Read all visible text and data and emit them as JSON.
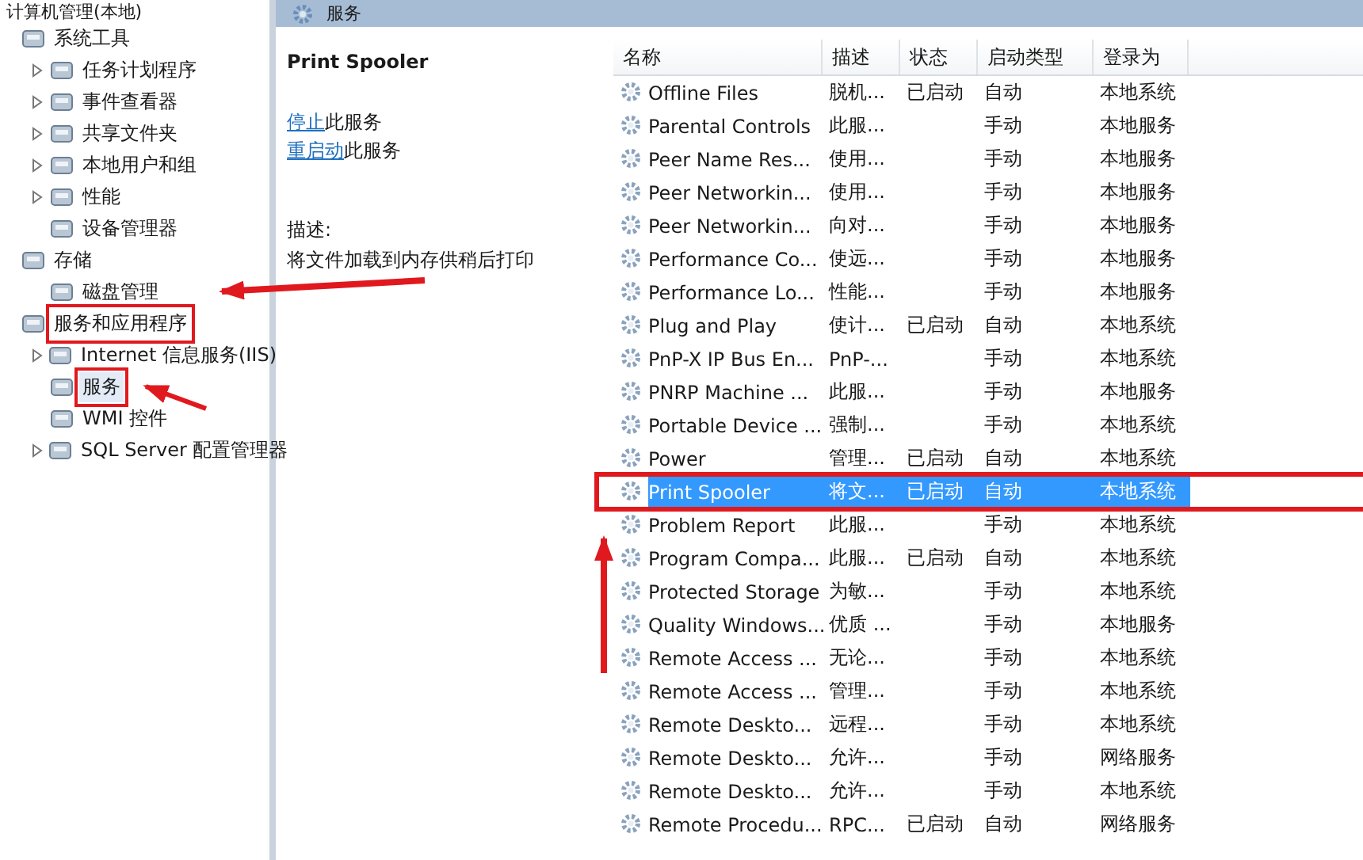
{
  "tree": {
    "label": "计算机管理(本地)",
    "children": [
      {
        "label": "系统工具",
        "expandable": false,
        "annotated": false,
        "selected": false,
        "children": [
          {
            "label": "任务计划程序",
            "expandable": true,
            "annotated": false,
            "selected": false
          },
          {
            "label": "事件查看器",
            "expandable": true,
            "annotated": false,
            "selected": false
          },
          {
            "label": "共享文件夹",
            "expandable": true,
            "annotated": false,
            "selected": false
          },
          {
            "label": "本地用户和组",
            "expandable": true,
            "annotated": false,
            "selected": false
          },
          {
            "label": "性能",
            "expandable": true,
            "annotated": false,
            "selected": false
          },
          {
            "label": "设备管理器",
            "expandable": false,
            "annotated": false,
            "selected": false
          }
        ]
      },
      {
        "label": "存储",
        "expandable": false,
        "annotated": false,
        "selected": false,
        "children": [
          {
            "label": "磁盘管理",
            "expandable": false,
            "annotated": false,
            "selected": false
          }
        ]
      },
      {
        "label": "服务和应用程序",
        "expandable": false,
        "annotated": true,
        "selected": false,
        "children": [
          {
            "label": "Internet 信息服务(IIS)",
            "expandable": true,
            "annotated": false,
            "selected": false
          },
          {
            "label": "服务",
            "expandable": false,
            "annotated": true,
            "selected": true
          },
          {
            "label": "WMI 控件",
            "expandable": false,
            "annotated": false,
            "selected": false
          },
          {
            "label": "SQL Server 配置管理器",
            "expandable": true,
            "annotated": false,
            "selected": false
          }
        ]
      }
    ]
  },
  "header": {
    "title": "服务"
  },
  "details": {
    "service_name": "Print Spooler",
    "actions": [
      {
        "link": "停止",
        "text": "此服务"
      },
      {
        "link": "重启动",
        "text": "此服务"
      }
    ],
    "description_label": "描述:",
    "description": "将文件加载到内存供稍后打印"
  },
  "table": {
    "columns": [
      "名称",
      "描述",
      "状态",
      "启动类型",
      "登录为"
    ],
    "rows": [
      {
        "name": "Offline Files",
        "description": "脱机...",
        "status": "已启动",
        "startup": "自动",
        "logon": "本地系统",
        "selected": false,
        "annotated": false
      },
      {
        "name": "Parental Controls",
        "description": "此服...",
        "status": "",
        "startup": "手动",
        "logon": "本地服务",
        "selected": false,
        "annotated": false
      },
      {
        "name": "Peer Name Res...",
        "description": "使用...",
        "status": "",
        "startup": "手动",
        "logon": "本地服务",
        "selected": false,
        "annotated": false
      },
      {
        "name": "Peer Networkin...",
        "description": "使用...",
        "status": "",
        "startup": "手动",
        "logon": "本地服务",
        "selected": false,
        "annotated": false
      },
      {
        "name": "Peer Networkin...",
        "description": "向对...",
        "status": "",
        "startup": "手动",
        "logon": "本地服务",
        "selected": false,
        "annotated": false
      },
      {
        "name": "Performance Co...",
        "description": "使远...",
        "status": "",
        "startup": "手动",
        "logon": "本地服务",
        "selected": false,
        "annotated": false
      },
      {
        "name": "Performance Lo...",
        "description": "性能...",
        "status": "",
        "startup": "手动",
        "logon": "本地服务",
        "selected": false,
        "annotated": false
      },
      {
        "name": "Plug and Play",
        "description": "使计...",
        "status": "已启动",
        "startup": "自动",
        "logon": "本地系统",
        "selected": false,
        "annotated": false
      },
      {
        "name": "PnP-X IP Bus En...",
        "description": "PnP-...",
        "status": "",
        "startup": "手动",
        "logon": "本地系统",
        "selected": false,
        "annotated": false
      },
      {
        "name": "PNRP Machine ...",
        "description": "此服...",
        "status": "",
        "startup": "手动",
        "logon": "本地服务",
        "selected": false,
        "annotated": false
      },
      {
        "name": "Portable Device ...",
        "description": "强制...",
        "status": "",
        "startup": "手动",
        "logon": "本地系统",
        "selected": false,
        "annotated": false
      },
      {
        "name": "Power",
        "description": "管理...",
        "status": "已启动",
        "startup": "自动",
        "logon": "本地系统",
        "selected": false,
        "annotated": false
      },
      {
        "name": "Print Spooler",
        "description": "将文...",
        "status": "已启动",
        "startup": "自动",
        "logon": "本地系统",
        "selected": true,
        "annotated": true
      },
      {
        "name": "Problem Report",
        "description": "此服...",
        "status": "",
        "startup": "手动",
        "logon": "本地系统",
        "selected": false,
        "annotated": false
      },
      {
        "name": "Program Compa...",
        "description": "此服...",
        "status": "已启动",
        "startup": "自动",
        "logon": "本地系统",
        "selected": false,
        "annotated": false
      },
      {
        "name": "Protected Storage",
        "description": "为敏...",
        "status": "",
        "startup": "手动",
        "logon": "本地系统",
        "selected": false,
        "annotated": false
      },
      {
        "name": "Quality Windows...",
        "description": "优质 ...",
        "status": "",
        "startup": "手动",
        "logon": "本地服务",
        "selected": false,
        "annotated": false
      },
      {
        "name": "Remote Access ...",
        "description": "无论...",
        "status": "",
        "startup": "手动",
        "logon": "本地系统",
        "selected": false,
        "annotated": false
      },
      {
        "name": "Remote Access ...",
        "description": "管理...",
        "status": "",
        "startup": "手动",
        "logon": "本地系统",
        "selected": false,
        "annotated": false
      },
      {
        "name": "Remote Deskto...",
        "description": "远程...",
        "status": "",
        "startup": "手动",
        "logon": "本地系统",
        "selected": false,
        "annotated": false
      },
      {
        "name": "Remote Deskto...",
        "description": "允许...",
        "status": "",
        "startup": "手动",
        "logon": "网络服务",
        "selected": false,
        "annotated": false
      },
      {
        "name": "Remote Deskto...",
        "description": "允许...",
        "status": "",
        "startup": "手动",
        "logon": "本地系统",
        "selected": false,
        "annotated": false
      },
      {
        "name": "Remote Procedu...",
        "description": "RPC...",
        "status": "已启动",
        "startup": "自动",
        "logon": "网络服务",
        "selected": false,
        "annotated": false
      }
    ]
  }
}
